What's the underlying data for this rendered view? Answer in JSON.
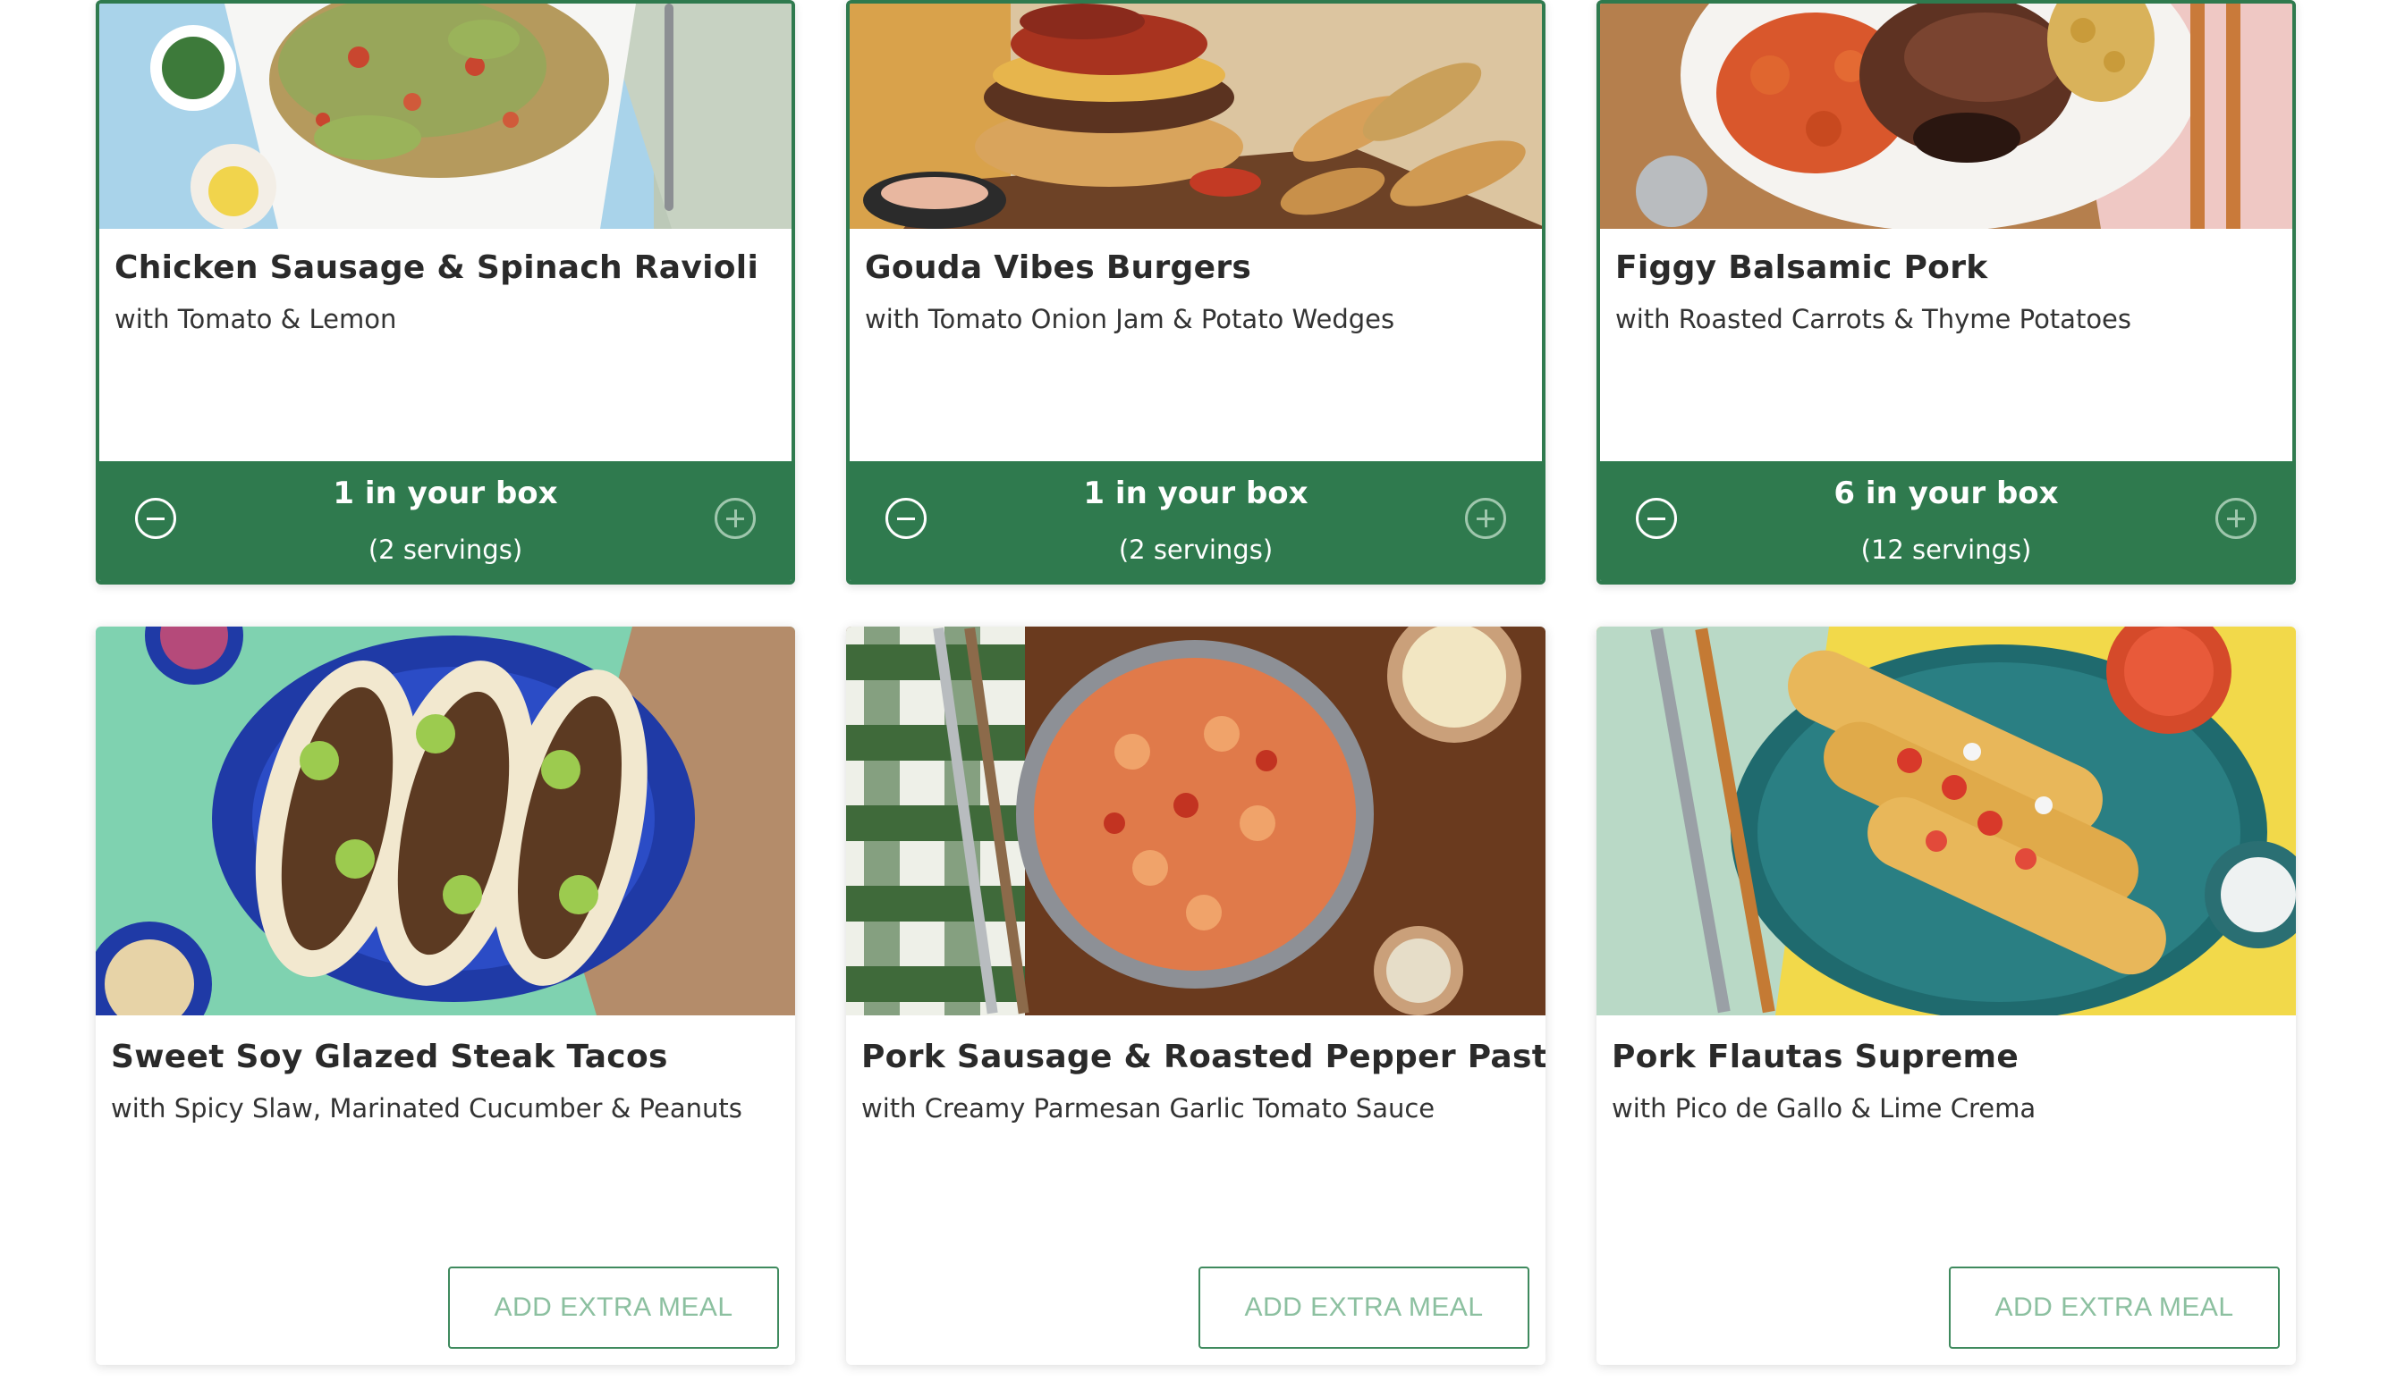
{
  "colors": {
    "brand_green": "#2f7a4e",
    "button_text_green": "#8cc0a0",
    "title_text": "#2a2a2a"
  },
  "meals": [
    {
      "title": "Chicken Sausage & Spinach Ravioli",
      "subtitle": "with Tomato & Lemon",
      "selected": true,
      "box": {
        "count_label": "1 in your box",
        "servings_label": "(2 servings)"
      },
      "icons": {
        "remove": "minus-circle-icon",
        "add": "plus-circle-icon"
      }
    },
    {
      "title": "Gouda Vibes Burgers",
      "subtitle": "with Tomato Onion Jam & Potato Wedges",
      "selected": true,
      "box": {
        "count_label": "1 in your box",
        "servings_label": "(2 servings)"
      },
      "icons": {
        "remove": "minus-circle-icon",
        "add": "plus-circle-icon"
      }
    },
    {
      "title": "Figgy Balsamic Pork",
      "subtitle": "with Roasted Carrots & Thyme Potatoes",
      "selected": true,
      "box": {
        "count_label": "6 in your box",
        "servings_label": "(12 servings)"
      },
      "icons": {
        "remove": "minus-circle-icon",
        "add": "plus-circle-icon"
      }
    },
    {
      "title": "Sweet Soy Glazed Steak Tacos",
      "subtitle": "with Spicy Slaw, Marinated Cucumber & Peanuts",
      "selected": false,
      "add_label": "ADD EXTRA MEAL"
    },
    {
      "title": "Pork Sausage & Roasted Pepper Pasta",
      "subtitle": "with Creamy Parmesan Garlic Tomato Sauce",
      "selected": false,
      "add_label": "ADD EXTRA MEAL"
    },
    {
      "title": "Pork Flautas Supreme",
      "subtitle": "with Pico de Gallo & Lime Crema",
      "selected": false,
      "add_label": "ADD EXTRA MEAL"
    }
  ]
}
